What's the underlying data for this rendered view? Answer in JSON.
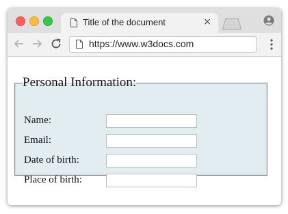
{
  "browser": {
    "tab": {
      "title": "Title of the document",
      "close_glyph": "×",
      "icon": "document-icon"
    },
    "traffic_lights": {
      "close_color": "#fc605c",
      "minimize_color": "#fdbc40",
      "maximize_color": "#34c84a"
    },
    "toolbar": {
      "back_icon": "arrow-left-icon",
      "forward_icon": "arrow-right-icon",
      "reload_icon": "reload-icon",
      "url": "https://www.w3docs.com",
      "menu_icon": "vertical-dots-icon",
      "profile_icon": "profile-icon"
    }
  },
  "page": {
    "legend": "Personal Information:",
    "background_color": "#e2edf1",
    "fields": [
      {
        "label": "Name:",
        "value": ""
      },
      {
        "label": "Email:",
        "value": ""
      },
      {
        "label": "Date of birth:",
        "value": ""
      },
      {
        "label": "Place of birth:",
        "value": ""
      }
    ]
  }
}
